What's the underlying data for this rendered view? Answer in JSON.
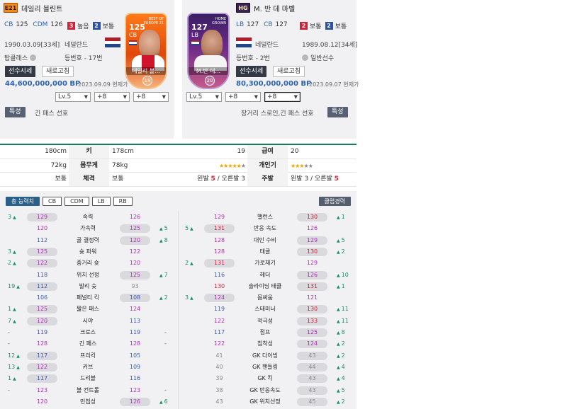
{
  "left_player": {
    "season": "E21",
    "name": "데일리 블린트",
    "pos1": "CB",
    "pos1_ovr": "125",
    "pos2": "CDM",
    "pos2_ovr": "126",
    "work_att_num": "3",
    "work_att": "높음",
    "work_def_num": "2",
    "work_def": "보통",
    "birth": "1990.03.09[33세]",
    "nation": "네덜란드",
    "club": "탑클래스",
    "squad_no": "등번호 - 17번",
    "price_btn": "선수시세",
    "refresh_btn": "새로고침",
    "price": "44,600,000,000 BP",
    "date": "2023.09.09 현재가",
    "lv": "Lv.5",
    "plus1": "+8",
    "plus2": "+8",
    "trait_btn": "특성",
    "trait": "긴 패스 선호",
    "card": {
      "ovr": "125",
      "pos": "CB",
      "name": "데일리 블...",
      "lv": "19",
      "top": "BEST OF EUROPE 21"
    }
  },
  "right_player": {
    "season": "HG",
    "name": "M. 반 데 마벨",
    "pos1": "LB",
    "pos1_ovr": "127",
    "pos2": "CB",
    "pos2_ovr": "127",
    "work_att_num": "2",
    "work_att": "보통",
    "work_def_num": "2",
    "work_def": "보통",
    "birth": "1989.08.12[34세]",
    "nation": "네덜란드",
    "club": "일반선수",
    "squad_no": "등번호 - 2번",
    "price_btn": "선수시세",
    "refresh_btn": "새로고침",
    "price": "80,300,000,000 BP",
    "date": "2023.09.07 현재가",
    "lv": "Lv.5",
    "plus1": "+8",
    "plus2": "+8",
    "trait_btn": "특성",
    "trait": "장거리 스로인,긴 패스 선호",
    "card": {
      "ovr": "127",
      "pos": "LB",
      "name": "M.반 데...",
      "lv": "20",
      "top": "HOME GROWN"
    }
  },
  "compare": {
    "height_label": "키",
    "height_l": "180cm",
    "height_r": "178cm",
    "weight_label": "몸무게",
    "weight_l": "72kg",
    "weight_r": "78kg",
    "body_label": "체격",
    "body_l": "보통",
    "body_r": "보통",
    "grade_label": "급여",
    "grade_l": "19",
    "grade_r": "20",
    "pop_label": "개인기",
    "pop_l": "★★★★★",
    "pop_l_off": "★",
    "pop_r": "★★★",
    "pop_r_off": "★★",
    "foot_label": "주발",
    "foot_l_pre": "왼발",
    "foot_l_a": "5",
    "foot_l_mid": "/ 오른발",
    "foot_l_b": "3",
    "foot_r_pre": "왼발",
    "foot_r_a": "3",
    "foot_r_mid": "/ 오른발",
    "foot_r_b": "5"
  },
  "stat_tabs": [
    "총 능력치",
    "CB",
    "CDM",
    "LB",
    "RB"
  ],
  "club_button": "클럽경력",
  "stats_left": [
    {
      "ld": "3",
      "lv": "129",
      "lp": true,
      "name": "속력",
      "rv": "126",
      "rp": false,
      "rd": "",
      "rneu": ""
    },
    {
      "ld": "",
      "lv": "120",
      "lp": false,
      "name": "가속력",
      "rv": "125",
      "rp": true,
      "rd": "5",
      "rneu": ""
    },
    {
      "ld": "",
      "lv": "112",
      "lp": false,
      "name": "골 결정력",
      "rv": "120",
      "rp": true,
      "rd": "8",
      "rneu": ""
    },
    {
      "ld": "3",
      "lv": "125",
      "lp": true,
      "name": "슛 파워",
      "rv": "122",
      "rp": false,
      "rd": "",
      "rneu": ""
    },
    {
      "ld": "2",
      "lv": "122",
      "lp": true,
      "name": "중거리 슛",
      "rv": "120",
      "rp": false,
      "rd": "",
      "rneu": ""
    },
    {
      "ld": "",
      "lv": "118",
      "lp": false,
      "name": "위치 선정",
      "rv": "125",
      "rp": true,
      "rd": "7",
      "rneu": ""
    },
    {
      "ld": "19",
      "lv": "112",
      "lp": true,
      "name": "발리 슛",
      "rv": "93",
      "rp": false,
      "rd": "",
      "rneu": ""
    },
    {
      "ld": "",
      "lv": "106",
      "lp": false,
      "name": "페널티 킥",
      "rv": "108",
      "rp": true,
      "rd": "2",
      "rneu": ""
    },
    {
      "ld": "1",
      "lv": "125",
      "lp": true,
      "name": "짧은 패스",
      "rv": "124",
      "rp": false,
      "rd": "",
      "rneu": ""
    },
    {
      "ld": "7",
      "lv": "120",
      "lp": true,
      "name": "시야",
      "rv": "113",
      "rp": false,
      "rd": "",
      "rneu": ""
    },
    {
      "ld": "-",
      "lv": "119",
      "lp": false,
      "name": "크로스",
      "rv": "119",
      "rp": false,
      "rd": "",
      "rneu": "-"
    },
    {
      "ld": "-",
      "lv": "128",
      "lp": false,
      "name": "긴 패스",
      "rv": "128",
      "rp": false,
      "rd": "",
      "rneu": "-"
    },
    {
      "ld": "12",
      "lv": "117",
      "lp": true,
      "name": "프리킥",
      "rv": "105",
      "rp": false,
      "rd": "",
      "rneu": ""
    },
    {
      "ld": "13",
      "lv": "122",
      "lp": true,
      "name": "커브",
      "rv": "109",
      "rp": false,
      "rd": "",
      "rneu": ""
    },
    {
      "ld": "1",
      "lv": "117",
      "lp": true,
      "name": "드리블",
      "rv": "116",
      "rp": false,
      "rd": "",
      "rneu": ""
    },
    {
      "ld": "-",
      "lv": "123",
      "lp": false,
      "name": "볼 컨트롤",
      "rv": "123",
      "rp": false,
      "rd": "",
      "rneu": "-"
    },
    {
      "ld": "",
      "lv": "120",
      "lp": false,
      "name": "민첩성",
      "rv": "126",
      "rp": true,
      "rd": "6",
      "rneu": ""
    }
  ],
  "stats_right": [
    {
      "ld": "",
      "lv": "129",
      "lp": false,
      "name": "밸런스",
      "rv": "130",
      "rp": true,
      "rd": "1",
      "rneu": ""
    },
    {
      "ld": "5",
      "lv": "131",
      "lp": true,
      "name": "반응 속도",
      "rv": "126",
      "rp": false,
      "rd": "",
      "rneu": ""
    },
    {
      "ld": "",
      "lv": "128",
      "lp": false,
      "name": "대인 수비",
      "rv": "129",
      "rp": true,
      "rd": "5",
      "rneu": ""
    },
    {
      "ld": "",
      "lv": "128",
      "lp": false,
      "name": "태클",
      "rv": "130",
      "rp": true,
      "rd": "2",
      "rneu": ""
    },
    {
      "ld": "2",
      "lv": "131",
      "lp": true,
      "name": "가로채기",
      "rv": "129",
      "rp": false,
      "rd": "",
      "rneu": ""
    },
    {
      "ld": "",
      "lv": "116",
      "lp": false,
      "name": "헤더",
      "rv": "126",
      "rp": true,
      "rd": "10",
      "rneu": ""
    },
    {
      "ld": "",
      "lv": "130",
      "lp": false,
      "name": "슬라이딩 태클",
      "rv": "131",
      "rp": true,
      "rd": "1",
      "rneu": ""
    },
    {
      "ld": "3",
      "lv": "124",
      "lp": true,
      "name": "몸싸움",
      "rv": "121",
      "rp": false,
      "rd": "",
      "rneu": ""
    },
    {
      "ld": "",
      "lv": "119",
      "lp": false,
      "name": "스태미너",
      "rv": "130",
      "rp": true,
      "rd": "11",
      "rneu": ""
    },
    {
      "ld": "",
      "lv": "122",
      "lp": false,
      "name": "적극성",
      "rv": "133",
      "rp": true,
      "rd": "11",
      "rneu": ""
    },
    {
      "ld": "",
      "lv": "117",
      "lp": false,
      "name": "점프",
      "rv": "125",
      "rp": true,
      "rd": "8",
      "rneu": ""
    },
    {
      "ld": "",
      "lv": "122",
      "lp": false,
      "name": "침착성",
      "rv": "124",
      "rp": true,
      "rd": "2",
      "rneu": ""
    },
    {
      "ld": "",
      "lv": "41",
      "lp": false,
      "name": "GK 다이빙",
      "rv": "43",
      "rp": true,
      "rd": "2",
      "rneu": ""
    },
    {
      "ld": "",
      "lv": "40",
      "lp": false,
      "name": "GK 핸들링",
      "rv": "44",
      "rp": true,
      "rd": "4",
      "rneu": ""
    },
    {
      "ld": "",
      "lv": "39",
      "lp": false,
      "name": "GK 킥",
      "rv": "43",
      "rp": true,
      "rd": "4",
      "rneu": ""
    },
    {
      "ld": "",
      "lv": "38",
      "lp": false,
      "name": "GK 반응속도",
      "rv": "43",
      "rp": true,
      "rd": "5",
      "rneu": ""
    },
    {
      "ld": "",
      "lv": "43",
      "lp": false,
      "name": "GK 위치선정",
      "rv": "45",
      "rp": true,
      "rd": "2",
      "rneu": ""
    }
  ],
  "colors": {
    "accent_green": "#17915a",
    "stat_blue": "#3b5bb5",
    "stat_red": "#d2223a",
    "stat_purple": "#b030b8",
    "header_line": "#167d58"
  }
}
